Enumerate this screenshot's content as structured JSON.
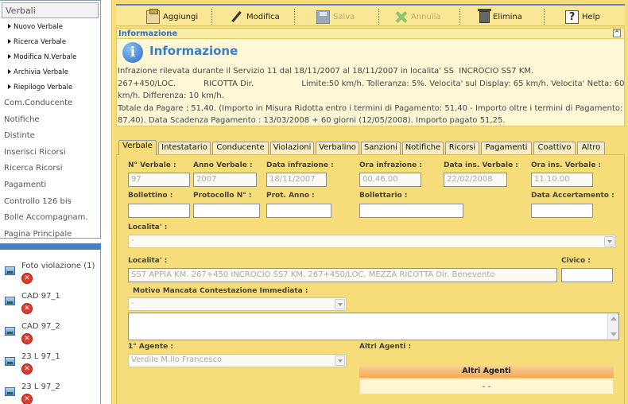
{
  "sidebar": {
    "header": "Verbali",
    "submenu": [
      "Nuovo Verbale",
      "Ricerca Verbale",
      "Modifica N.Verbale",
      "Archivia Verbale",
      "Riepilogo Verbale"
    ],
    "mainmenu": [
      "Com.Conducente",
      "Notifiche",
      "Distinte",
      "Inserisci Ricorsi",
      "Ricerca Ricorsi",
      "Pagamenti",
      "Controllo 126 bis",
      "Bolle Accompagnam.",
      "Pagina Principale"
    ],
    "photos": [
      {
        "name": "Foto violazione (1)"
      },
      {
        "name": "CAD 97_1"
      },
      {
        "name": "CAD 97_2"
      },
      {
        "name": "23 L 97_1"
      },
      {
        "name": "23 L 97_2"
      }
    ],
    "delete_glyph": "✕"
  },
  "toolbar": {
    "aggiungi": "Aggiungi",
    "modifica": "Modifica",
    "salva": "Salva",
    "annulla": "Annulla",
    "elimina": "Elimina",
    "help": "Help",
    "help_glyph": "?"
  },
  "info": {
    "bar_title": "Informazione",
    "collapse_glyph": "^",
    "icon_glyph": "i",
    "title": "Informazione",
    "lines": [
      "Infrazione rilevata durante il Servizio 11 dal 18/11/2007 al 18/11/2007 in localita' SS  INCROCIO SS7 KM.",
      "267+450/LOC.           RICOTTA Dir.                   Limite:50 km/h. Tolleranza: 5%. Velocita' sul Display: 65 km/h. Velocita' Netta: 60",
      "km/h. Differenza: 10 km/h.",
      "Totale da Pagare : 51,40. (Importo in Misura Ridotta entro i termini di Pagamento: 51,40 - Importo oltre i termini di Pagamento:",
      "87,40). Data Scadenza Pagamento : 13/03/2008 + 60 giorni (12/05/2008). Importo pagato 51,25."
    ]
  },
  "tabs": [
    "Verbale",
    "Intestatario",
    "Conducente",
    "Violazioni",
    "Verbalino",
    "Sanzioni",
    "Notifiche",
    "Ricorsi",
    "Pagamenti",
    "Coattivo",
    "Altro"
  ],
  "form": {
    "n_verbale_label": "N° Verbale :",
    "n_verbale": "97",
    "anno_verbale_label": "Anno Verbale :",
    "anno_verbale": "2007",
    "data_infrazione_label": "Data infrazione :",
    "data_infrazione": "18/11/2007",
    "ora_infrazione_label": "Ora infrazione :",
    "ora_infrazione": "00.46.00",
    "data_ins_label": "Data ins. Verbale :",
    "data_ins": "22/02/2008",
    "ora_ins_label": "Ora ins. Verbale :",
    "ora_ins": "11.10.00",
    "bollettino_label": "Bollettino :",
    "bollettino": "",
    "protocollo_label": "Protocollo N° :",
    "protocollo": "",
    "prot_anno_label": "Prot. Anno :",
    "prot_anno": "",
    "bollettario_label": "Bollettario :",
    "bollettario": "",
    "data_accertamento_label": "Data Accertamento :",
    "data_accertamento": "",
    "localita1_label": "Localita' :",
    "localita1": "-",
    "localita2_label": "Localita' :",
    "localita2": "SS7 APPIA KM. 267+450 INCROCIO SS7 KM. 267+450/LOC. MEZZA RICOTTA Dir. Benevento",
    "civico_label": "Civico :",
    "civico": "",
    "motivo_label": "Motivo Mancata Contestazione Immediata :",
    "motivo": "-",
    "agente_label": "1° Agente :",
    "agente": "Verdile M.llo Francesco",
    "altri_label": "Altri Agenti :",
    "altri_head": "Altri Agenti",
    "altri_value": "- -"
  }
}
